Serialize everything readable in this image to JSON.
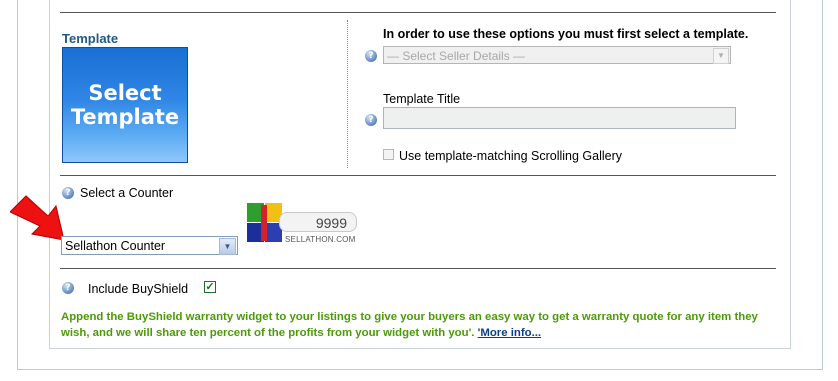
{
  "template": {
    "label": "Template",
    "button_label": "Select\nTemplate"
  },
  "options": {
    "notice": "In order to use these options you must first select a template.",
    "seller_select": {
      "value": "— Select Seller Details —"
    },
    "template_title_label": "Template Title",
    "template_title_value": "",
    "scrolling_gallery_label": "Use template-matching Scrolling Gallery"
  },
  "counter": {
    "label": "Select a Counter",
    "selected": "Sellathon Counter",
    "preview_digits": "9999",
    "preview_brand": "SELLATHON.COM"
  },
  "buyshield": {
    "label": "Include BuyShield",
    "checked": true,
    "description": "Append the BuyShield warranty widget to your listings to give your buyers an easy way to get a warranty quote for any item they wish, and we will share ten percent of the profits from your widget with you'.",
    "more_info": "'More info..."
  },
  "colors": {
    "template_label": "#1d5a88",
    "promo_text": "#4b9b07",
    "link": "#0b3f8a",
    "pointer_arrow": "#ee1111"
  },
  "icons": [
    "help-icon",
    "arrow-pointer-icon",
    "sellathon-cube-icon"
  ]
}
